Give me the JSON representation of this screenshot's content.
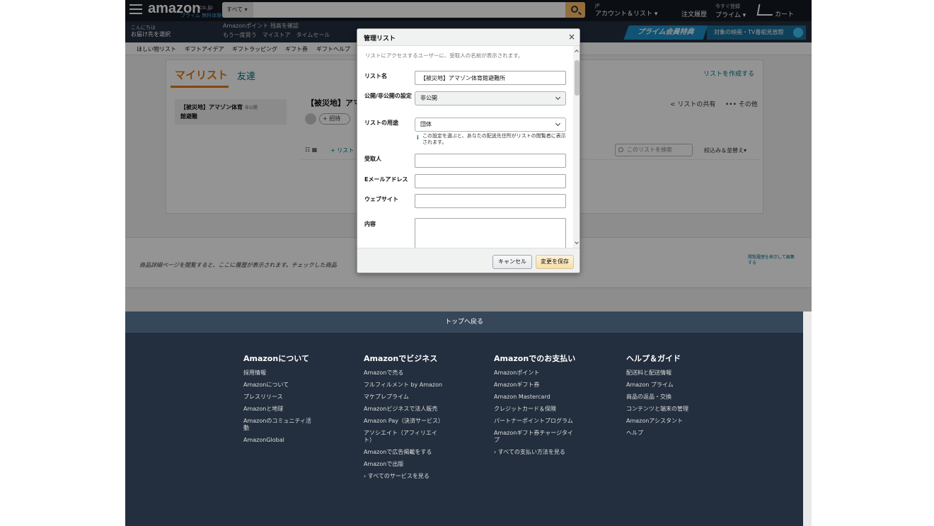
{
  "header": {
    "logo": "amazon",
    "logo_tld": ".co.jp",
    "logo_prime": "プライム 無料体験",
    "search_category": "すべて ▾",
    "account_greeting": "JP",
    "account_label": "アカウント＆リスト ▾",
    "orders_label": "注文履歴",
    "prime_small": "今すぐ登録",
    "prime_label": "プライム ▾",
    "cart_label": "カート",
    "location_small": "こんにちは",
    "location_label": "お届け先を選択",
    "sub_line1": "Amazonポイント 残高を確認",
    "sub_line2": "もう一度買う　マイストア　タイムセール",
    "prime_banner": "プライム会員特典",
    "tv_banner": "対象の映画・TV番組見放題"
  },
  "nav": {
    "items": [
      "ほしい物リスト",
      "ギフトアイデア",
      "ギフトラッピング",
      "ギフト券",
      "ギフトヘルプ"
    ]
  },
  "main": {
    "tab_mylist": "マイリスト",
    "tab_friends": "友達",
    "create_list": "リストを作成する",
    "side_item_title": "【被災地】アマゾン体育",
    "side_item_tag": "非公開",
    "side_item_title2": "館避難",
    "list_title": "【被災地】アマ",
    "invite": "+ 招待",
    "share": "< リストの共有",
    "more": "••• その他",
    "view_icons": "☷ ▦",
    "add_item": "+ リスト",
    "list_search": "このリストを検索",
    "filter_sort": "絞込み＆並替え▾"
  },
  "history": {
    "text": "商品詳細ページを閲覧すると、ここに履歴が表示されます。チェックした商品",
    "side": "閲覧履歴を表示して編集する"
  },
  "footer": {
    "back_to_top": "トップへ戻る",
    "columns": [
      {
        "title": "Amazonについて",
        "links": [
          "採用情報",
          "Amazonについて",
          "プレスリリース",
          "Amazonと地球",
          "Amazonのコミュニティ活動",
          "AmazonGlobal"
        ]
      },
      {
        "title": "Amazonでビジネス",
        "links": [
          "Amazonで売る",
          "フルフィルメント by Amazon",
          "マケプレプライム",
          "Amazonビジネスで法人販売",
          "Amazon Pay（決済サービス）",
          "アソシエイト（アフィリエイト）",
          "Amazonで広告掲載をする",
          "Amazonで出版",
          "› すべてのサービスを見る"
        ]
      },
      {
        "title": "Amazonでのお支払い",
        "links": [
          "Amazonポイント",
          "Amazonギフト券",
          "Amazon Mastercard",
          "クレジットカード＆保険",
          "パートナーポイントプログラム",
          "Amazonギフト券チャージタイプ",
          "› すべての支払い方法を見る"
        ]
      },
      {
        "title": "ヘルプ＆ガイド",
        "links": [
          "配送料と配送情報",
          "Amazon プライム",
          "商品の返品・交換",
          "コンテンツと端末の管理",
          "Amazonアシスタント",
          "ヘルプ"
        ]
      }
    ]
  },
  "dialog": {
    "title": "管理リスト",
    "close": "×",
    "note": "リストにアクセスするユーザーに、受取人の名前が表示されます。",
    "list_name_label": "リスト名",
    "list_name_value": "【被災地】アマゾン体育館避難所",
    "visibility_label": "公開/非公開の設定",
    "visibility_value": "非公開",
    "purpose_label": "リストの用途",
    "purpose_value": "団体",
    "purpose_info": "この設定を選ぶと、あなたの配送先住所がリストの閲覧者に表示されます。",
    "recipient_label": "受取人",
    "recipient_value": "",
    "email_label": "Eメールアドレス",
    "email_value": "",
    "website_label": "ウェブサイト",
    "website_value": "",
    "content_label": "内容",
    "cancel": "キャンセル",
    "save": "変更を保存"
  }
}
